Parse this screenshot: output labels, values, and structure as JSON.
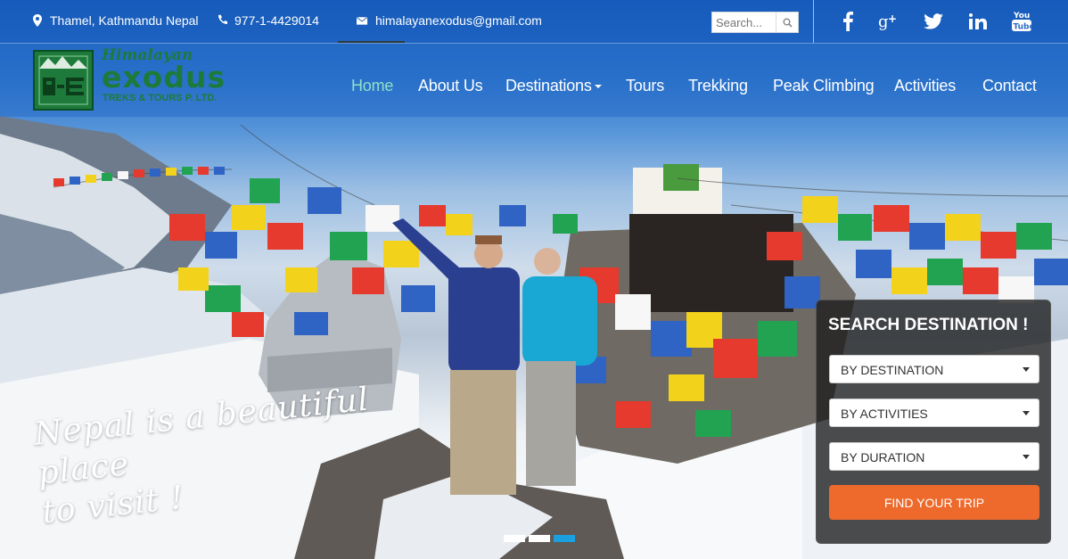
{
  "topbar": {
    "location": "Thamel, Kathmandu Nepal",
    "phone": "977-1-4429014",
    "email": "himalayanexodus@gmail.com",
    "search_placeholder": "Search...",
    "social": [
      "facebook-icon",
      "google-plus-icon",
      "twitter-icon",
      "linkedin-icon",
      "youtube-icon"
    ]
  },
  "brand": {
    "script": "Himalayan",
    "name": "exodus",
    "sub": "TREKS & TOURS P. LTD."
  },
  "nav": {
    "items": [
      "Home",
      "About Us",
      "Destinations",
      "Tours",
      "Trekking",
      "Peak Climbing",
      "Activities",
      "Contact"
    ],
    "active": "Home"
  },
  "hero": {
    "tagline_line1": "Nepal is a beautiful place",
    "tagline_line2": "to visit !",
    "slides": 3,
    "active_slide": 3
  },
  "search_panel": {
    "title": "SEARCH DESTINATION !",
    "destination": "BY DESTINATION",
    "activities": "BY ACTIVITIES",
    "duration": "BY DURATION",
    "button": "FIND YOUR TRIP"
  },
  "colors": {
    "accent_orange": "#ee6a2c",
    "nav_active": "#8fe0c8",
    "logo_green": "#1e7a3a",
    "dot_active": "#1aa0e0"
  }
}
